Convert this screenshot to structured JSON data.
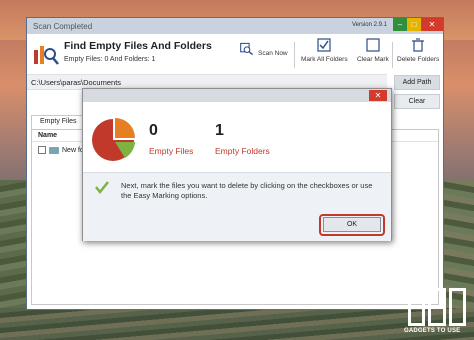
{
  "window": {
    "title": "Scan Completed",
    "version": "Version 2.9.1",
    "minimize": "–",
    "maximize": "□",
    "close": "✕"
  },
  "header": {
    "app_name": "Find Empty Files And Folders",
    "summary": "Empty Files: 0 And Folders: 1"
  },
  "toolbar": {
    "scan_now": "Scan Now",
    "mark_all": "Mark All Folders",
    "clear_mark": "Clear Mark",
    "delete_folders": "Delete Folders"
  },
  "path": {
    "value": "C:\\Users\\paras\\Documents",
    "add_path": "Add Path",
    "clear": "Clear"
  },
  "tabs": [
    "Empty Files"
  ],
  "list": {
    "header_name": "Name",
    "rows": [
      {
        "name": "New fol"
      }
    ]
  },
  "dialog": {
    "close": "✕",
    "empty_files_count": "0",
    "empty_files_label": "Empty Files",
    "empty_folders_count": "1",
    "empty_folders_label": "Empty Folders",
    "message": "Next, mark the files you want to delete by clicking on the checkboxes or use the Easy Marking options.",
    "ok": "OK",
    "accent_color": "#c0392b"
  },
  "watermark": {
    "text": "GADGETS TO USE"
  }
}
